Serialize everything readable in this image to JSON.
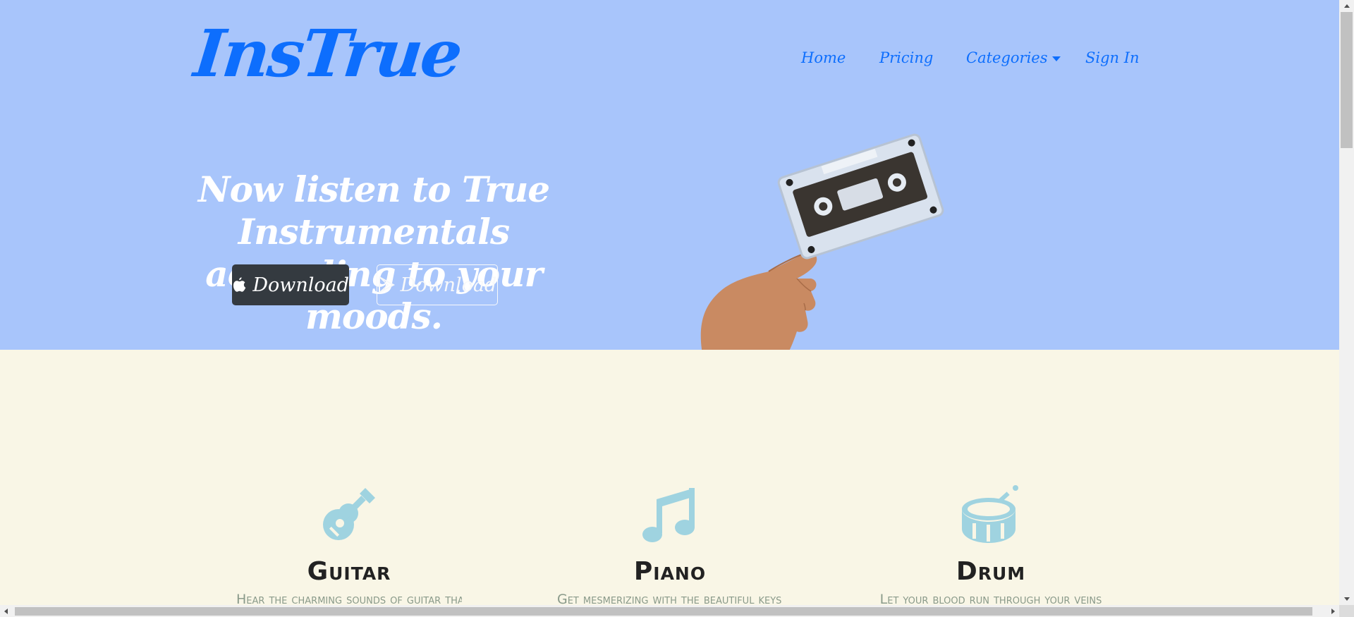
{
  "brand": "InsTrue",
  "nav": {
    "home": "Home",
    "pricing": "Pricing",
    "categories": "Categories",
    "signin": "Sign In"
  },
  "hero": {
    "headline_part1": "Now listen to",
    "headline_strong": "True Instrumentals",
    "headline_part2": "according to your moods.",
    "apple_button": "Download",
    "play_button": "Download"
  },
  "features": [
    {
      "icon": "guitar-icon",
      "title": "Guitar",
      "text": "Hear the charming sounds of guitar that"
    },
    {
      "icon": "music-note-icon",
      "title": "Piano",
      "text": "Get mesmerizing with the beautiful keys of"
    },
    {
      "icon": "drum-icon",
      "title": "Drum",
      "text": "Let your blood run through your veins"
    }
  ],
  "colors": {
    "hero_bg": "#a8c5fb",
    "accent": "#0d6efd",
    "features_bg": "#f9f6e6",
    "icon": "#9fd3e0",
    "dark_button": "#343a40"
  }
}
